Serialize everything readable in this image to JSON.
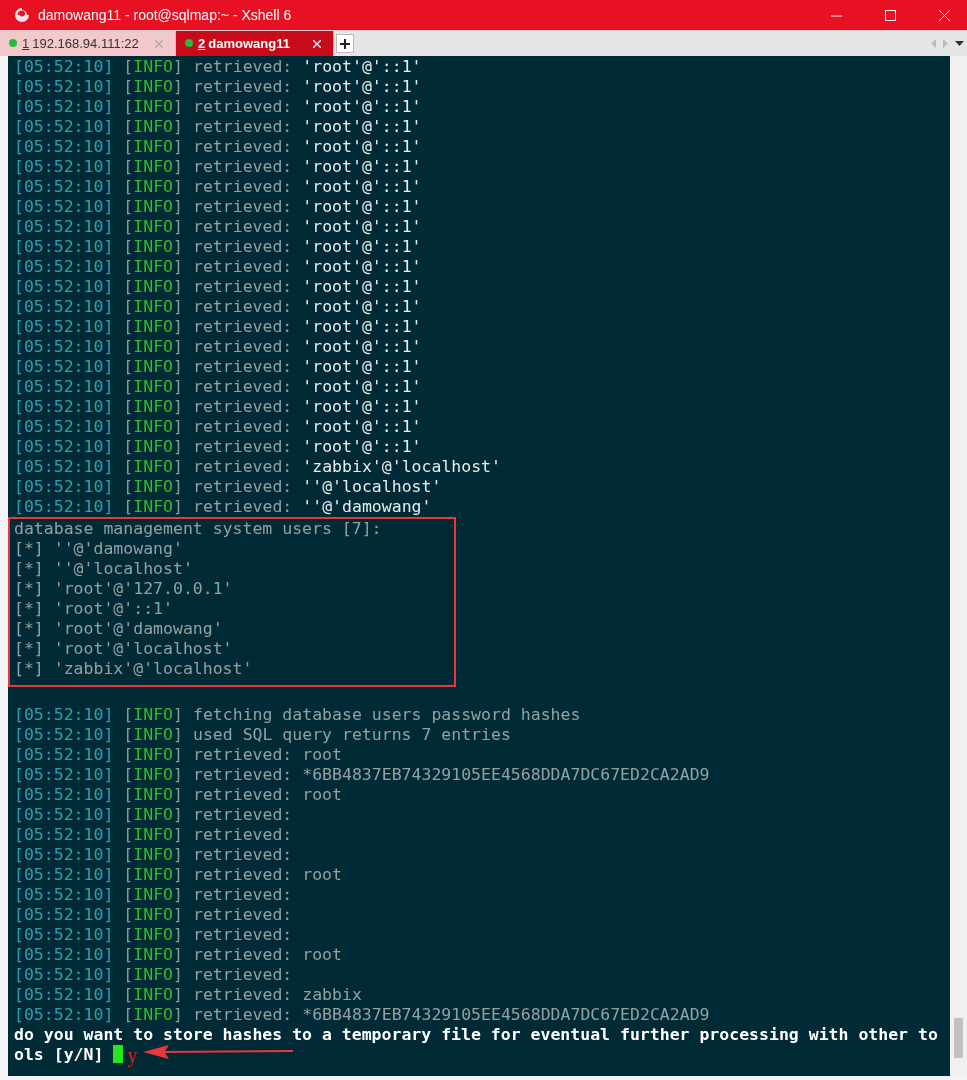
{
  "window": {
    "title": "damowang11 - root@sqlmap:~ - Xshell 6"
  },
  "tabs": [
    {
      "number": "1",
      "label": "192.168.94.111:22",
      "selected": false,
      "connected": true
    },
    {
      "number": "2",
      "label": "damowang11",
      "selected": true,
      "connected": true
    }
  ],
  "terminal": {
    "lines": [
      {
        "kind": "log",
        "time": "[05:52:10]",
        "level": "[INFO]",
        "message": "retrieved:",
        "value": "'root'@'::1'"
      },
      {
        "kind": "log",
        "time": "[05:52:10]",
        "level": "[INFO]",
        "message": "retrieved:",
        "value": "'root'@'::1'"
      },
      {
        "kind": "log",
        "time": "[05:52:10]",
        "level": "[INFO]",
        "message": "retrieved:",
        "value": "'root'@'::1'"
      },
      {
        "kind": "log",
        "time": "[05:52:10]",
        "level": "[INFO]",
        "message": "retrieved:",
        "value": "'root'@'::1'"
      },
      {
        "kind": "log",
        "time": "[05:52:10]",
        "level": "[INFO]",
        "message": "retrieved:",
        "value": "'root'@'::1'"
      },
      {
        "kind": "log",
        "time": "[05:52:10]",
        "level": "[INFO]",
        "message": "retrieved:",
        "value": "'root'@'::1'"
      },
      {
        "kind": "log",
        "time": "[05:52:10]",
        "level": "[INFO]",
        "message": "retrieved:",
        "value": "'root'@'::1'"
      },
      {
        "kind": "log",
        "time": "[05:52:10]",
        "level": "[INFO]",
        "message": "retrieved:",
        "value": "'root'@'::1'"
      },
      {
        "kind": "log",
        "time": "[05:52:10]",
        "level": "[INFO]",
        "message": "retrieved:",
        "value": "'root'@'::1'"
      },
      {
        "kind": "log",
        "time": "[05:52:10]",
        "level": "[INFO]",
        "message": "retrieved:",
        "value": "'root'@'::1'"
      },
      {
        "kind": "log",
        "time": "[05:52:10]",
        "level": "[INFO]",
        "message": "retrieved:",
        "value": "'root'@'::1'"
      },
      {
        "kind": "log",
        "time": "[05:52:10]",
        "level": "[INFO]",
        "message": "retrieved:",
        "value": "'root'@'::1'"
      },
      {
        "kind": "log",
        "time": "[05:52:10]",
        "level": "[INFO]",
        "message": "retrieved:",
        "value": "'root'@'::1'"
      },
      {
        "kind": "log",
        "time": "[05:52:10]",
        "level": "[INFO]",
        "message": "retrieved:",
        "value": "'root'@'::1'"
      },
      {
        "kind": "log",
        "time": "[05:52:10]",
        "level": "[INFO]",
        "message": "retrieved:",
        "value": "'root'@'::1'"
      },
      {
        "kind": "log",
        "time": "[05:52:10]",
        "level": "[INFO]",
        "message": "retrieved:",
        "value": "'root'@'::1'"
      },
      {
        "kind": "log",
        "time": "[05:52:10]",
        "level": "[INFO]",
        "message": "retrieved:",
        "value": "'root'@'::1'"
      },
      {
        "kind": "log",
        "time": "[05:52:10]",
        "level": "[INFO]",
        "message": "retrieved:",
        "value": "'root'@'::1'"
      },
      {
        "kind": "log",
        "time": "[05:52:10]",
        "level": "[INFO]",
        "message": "retrieved:",
        "value": "'root'@'::1'"
      },
      {
        "kind": "log",
        "time": "[05:52:10]",
        "level": "[INFO]",
        "message": "retrieved:",
        "value": "'root'@'::1'"
      },
      {
        "kind": "log",
        "time": "[05:52:10]",
        "level": "[INFO]",
        "message": "retrieved:",
        "value": "'zabbix'@'localhost'"
      },
      {
        "kind": "log",
        "time": "[05:52:10]",
        "level": "[INFO]",
        "message": "retrieved:",
        "value": "''@'localhost'"
      },
      {
        "kind": "log",
        "time": "[05:52:10]",
        "level": "[INFO]",
        "message": "retrieved:",
        "value": "''@'damowang'"
      },
      {
        "kind": "box",
        "heading": "database management system users [7]:",
        "items": [
          "[*] ''@'damowang'",
          "[*] ''@'localhost'",
          "[*] 'root'@'127.0.0.1'",
          "[*] 'root'@'::1'",
          "[*] 'root'@'damowang'",
          "[*] 'root'@'localhost'",
          "[*] 'zabbix'@'localhost'"
        ]
      },
      {
        "kind": "log",
        "time": "[05:52:10]",
        "level": "[INFO]",
        "message": "fetching database users password hashes"
      },
      {
        "kind": "log",
        "time": "[05:52:10]",
        "level": "[INFO]",
        "message": "used SQL query returns 7 entries"
      },
      {
        "kind": "log",
        "time": "[05:52:10]",
        "level": "[INFO]",
        "message": "retrieved: root"
      },
      {
        "kind": "log",
        "time": "[05:52:10]",
        "level": "[INFO]",
        "message": "retrieved: *6BB4837EB74329105EE4568DDA7DC67ED2CA2AD9"
      },
      {
        "kind": "log",
        "time": "[05:52:10]",
        "level": "[INFO]",
        "message": "retrieved: root"
      },
      {
        "kind": "log",
        "time": "[05:52:10]",
        "level": "[INFO]",
        "message": "retrieved:"
      },
      {
        "kind": "log",
        "time": "[05:52:10]",
        "level": "[INFO]",
        "message": "retrieved:"
      },
      {
        "kind": "log",
        "time": "[05:52:10]",
        "level": "[INFO]",
        "message": "retrieved:"
      },
      {
        "kind": "log",
        "time": "[05:52:10]",
        "level": "[INFO]",
        "message": "retrieved: root"
      },
      {
        "kind": "log",
        "time": "[05:52:10]",
        "level": "[INFO]",
        "message": "retrieved:"
      },
      {
        "kind": "log",
        "time": "[05:52:10]",
        "level": "[INFO]",
        "message": "retrieved:"
      },
      {
        "kind": "log",
        "time": "[05:52:10]",
        "level": "[INFO]",
        "message": "retrieved:"
      },
      {
        "kind": "log",
        "time": "[05:52:10]",
        "level": "[INFO]",
        "message": "retrieved: root"
      },
      {
        "kind": "log",
        "time": "[05:52:10]",
        "level": "[INFO]",
        "message": "retrieved:"
      },
      {
        "kind": "log",
        "time": "[05:52:10]",
        "level": "[INFO]",
        "message": "retrieved: zabbix"
      },
      {
        "kind": "log",
        "time": "[05:52:10]",
        "level": "[INFO]",
        "message": "retrieved: *6BB4837EB74329105EE4568DDA7DC67ED2CA2AD9"
      },
      {
        "kind": "prompt",
        "text": "do you want to store hashes to a temporary file for eventual further processing with other to"
      },
      {
        "kind": "answer",
        "text": "ols [y/N]",
        "input": "y"
      }
    ]
  }
}
